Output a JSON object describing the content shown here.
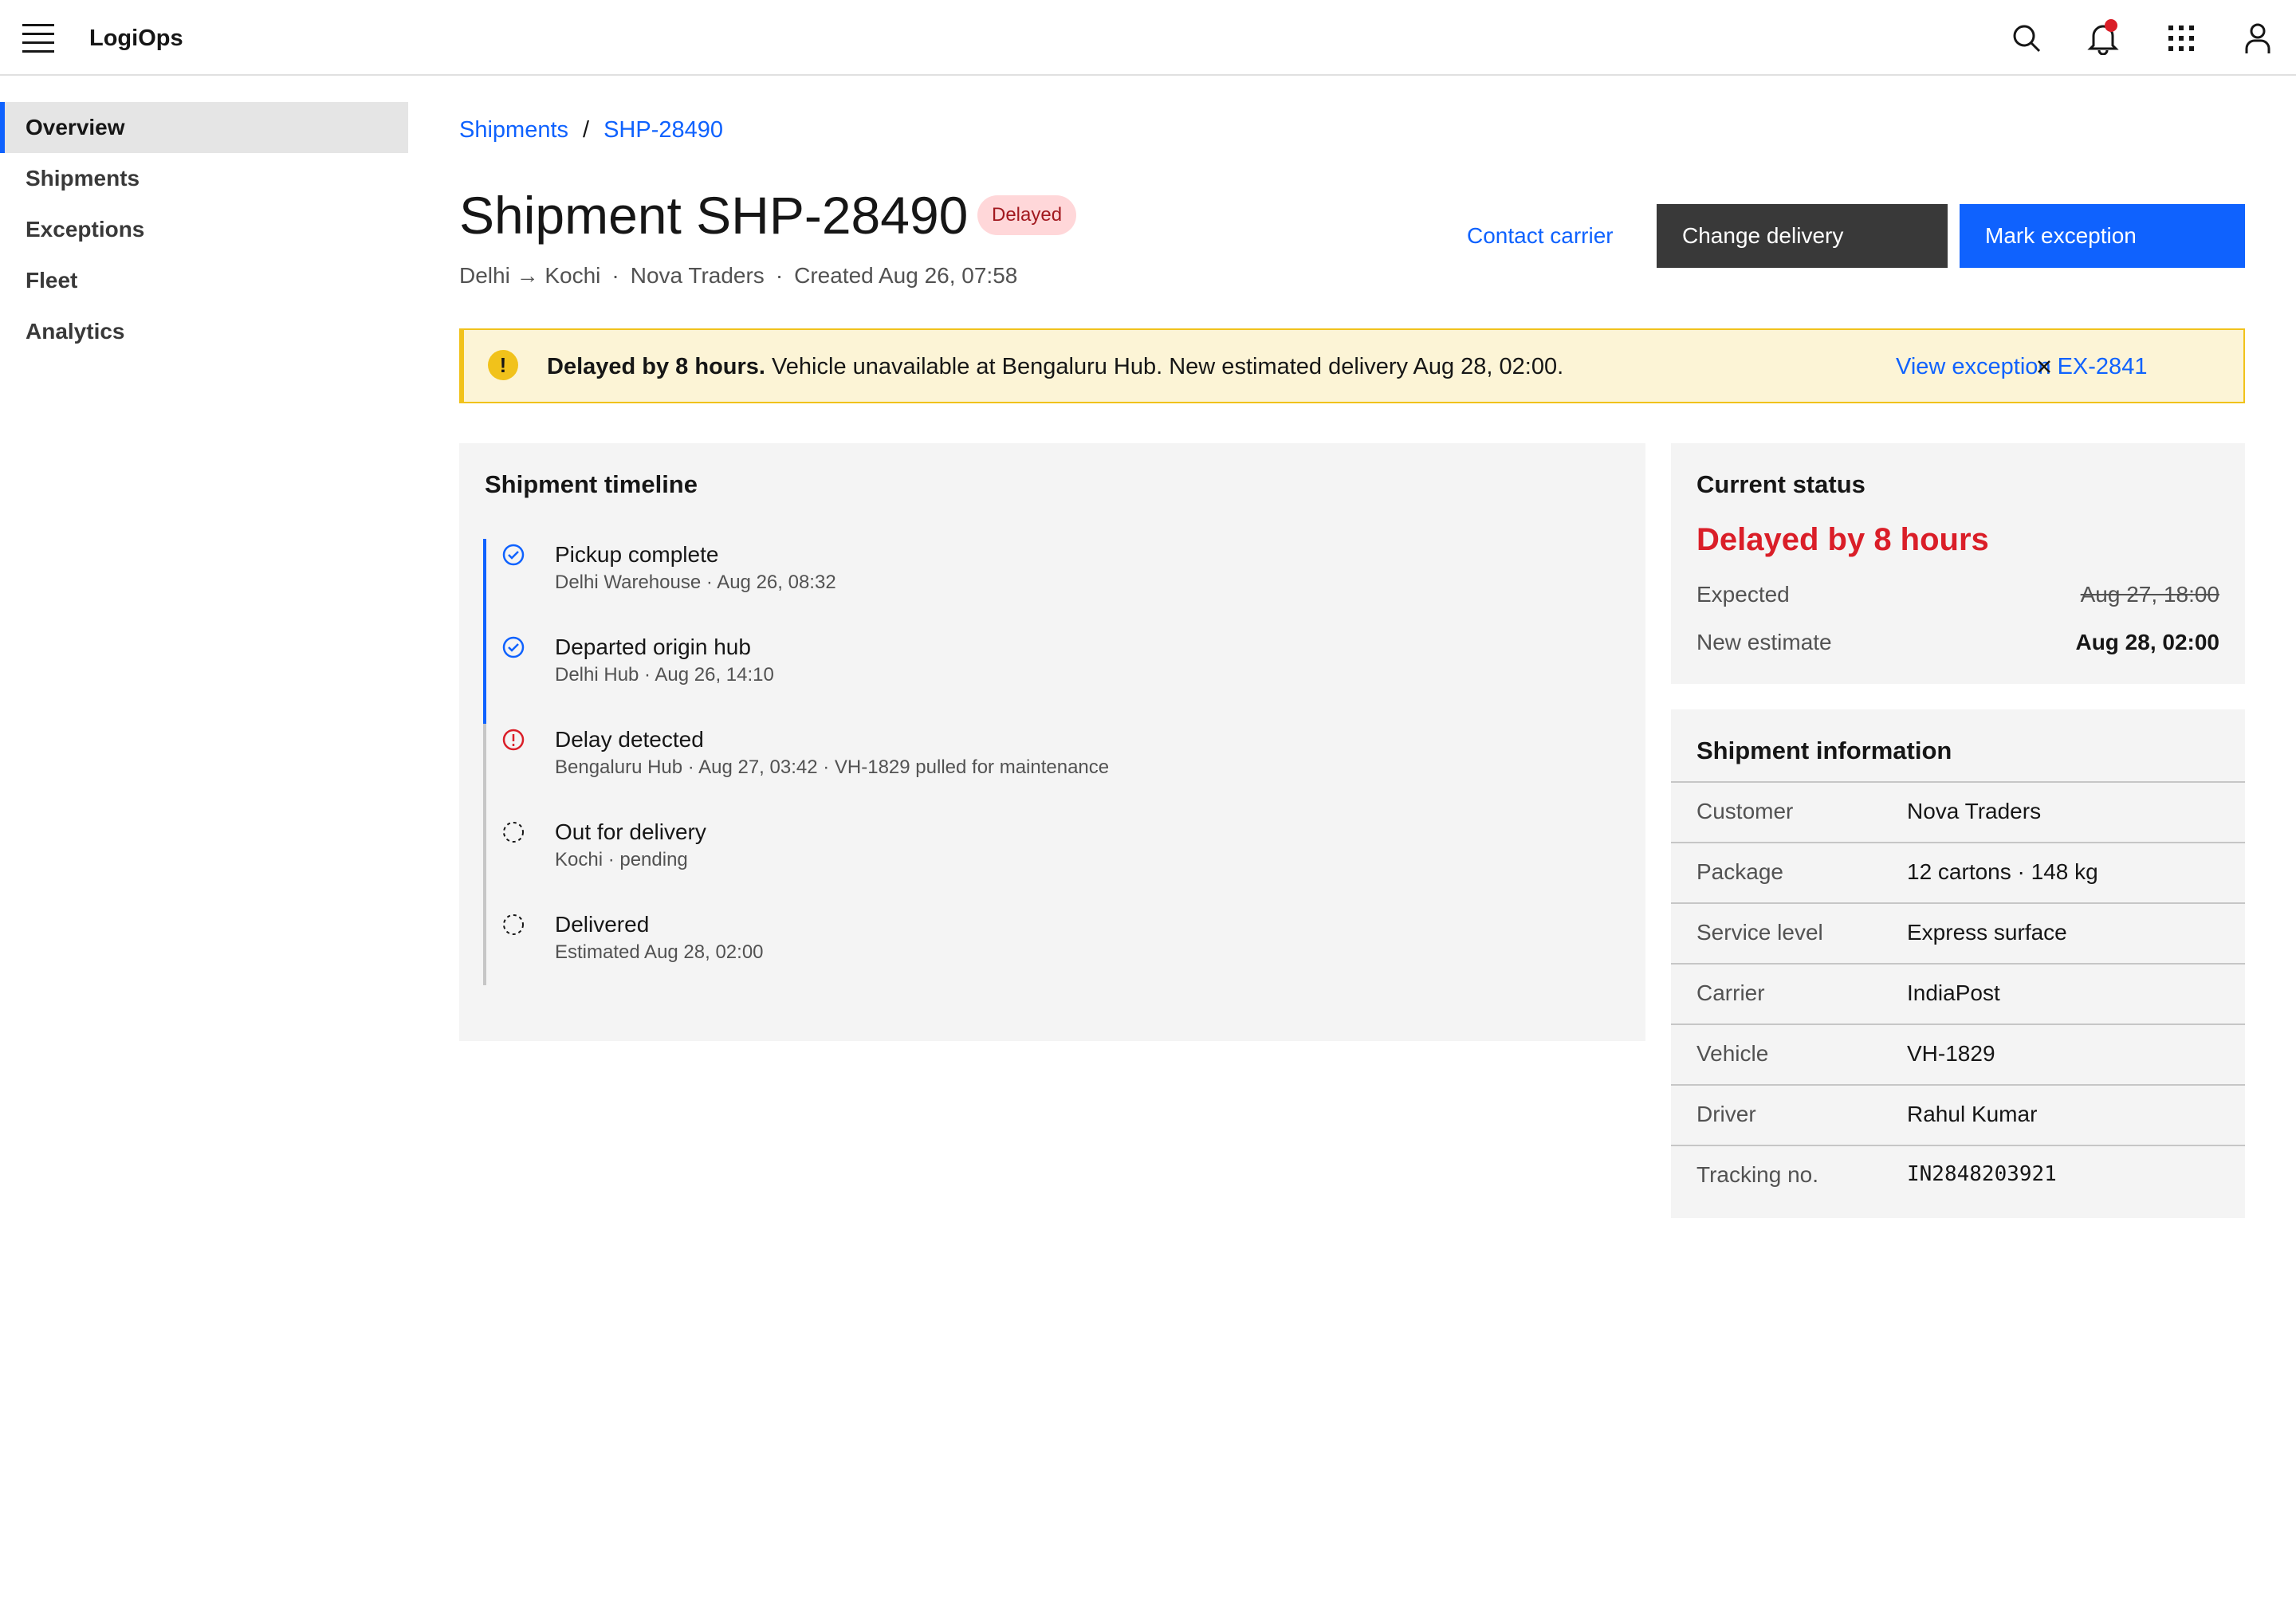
{
  "header": {
    "app_name": "LogiOps",
    "icons": [
      "menu-icon",
      "search-icon",
      "bell-icon",
      "app-switcher-icon",
      "user-icon"
    ],
    "has_notification": true
  },
  "sidebar": {
    "items": [
      {
        "label": "Overview",
        "active": true
      },
      {
        "label": "Shipments",
        "active": false
      },
      {
        "label": "Exceptions",
        "active": false
      },
      {
        "label": "Fleet",
        "active": false
      },
      {
        "label": "Analytics",
        "active": false
      }
    ]
  },
  "breadcrumb": {
    "items": [
      "Shipments",
      "SHP-28490"
    ],
    "separator": "/"
  },
  "page": {
    "title": "Shipment SHP-28490",
    "status_tag": "Delayed",
    "route": "Delhi → Kochi",
    "customer": "Nova Traders",
    "created": "Created Aug 26, 07:58",
    "separator": "·"
  },
  "actions": {
    "contact_carrier": "Contact carrier",
    "change_delivery": "Change delivery",
    "mark_exception": "Mark exception"
  },
  "banner": {
    "bold_text": "Delayed by 8 hours.",
    "text": " Vehicle unavailable at Bengaluru Hub. New estimated delivery Aug 28, 02:00.",
    "link": "View exception EX-2841"
  },
  "timeline": {
    "title": "Shipment timeline",
    "events": [
      {
        "title": "Pickup complete",
        "detail": "Delhi Warehouse · Aug 26, 08:32",
        "state": "done"
      },
      {
        "title": "Departed origin hub",
        "detail": "Delhi Hub · Aug 26, 14:10",
        "state": "done"
      },
      {
        "title": "Delay detected",
        "detail": "Bengaluru Hub · Aug 27, 03:42 · VH-1829 pulled for maintenance",
        "state": "error"
      },
      {
        "title": "Out for delivery",
        "detail": "Kochi · pending",
        "state": "pending"
      },
      {
        "title": "Delivered",
        "detail": "Estimated Aug 28, 02:00",
        "state": "pending"
      }
    ]
  },
  "current_status": {
    "title": "Current status",
    "headline": "Delayed by 8 hours",
    "expected_label": "Expected",
    "expected_value": "Aug 27, 18:00",
    "new_estimate_label": "New estimate",
    "new_estimate_value": "Aug 28, 02:00"
  },
  "shipment_info": {
    "title": "Shipment information",
    "rows": [
      {
        "label": "Customer",
        "value": "Nova Traders"
      },
      {
        "label": "Package",
        "value": "12 cartons · 148 kg"
      },
      {
        "label": "Service level",
        "value": "Express surface"
      },
      {
        "label": "Carrier",
        "value": "IndiaPost"
      },
      {
        "label": "Vehicle",
        "value": "VH-1829"
      },
      {
        "label": "Driver",
        "value": "Rahul Kumar"
      },
      {
        "label": "Tracking no.",
        "value": "IN2848203921"
      }
    ]
  },
  "colors": {
    "accent": "#0f62fe",
    "danger": "#da1e28",
    "warning": "#f1c21b",
    "warning_bg": "#fcf4d6"
  }
}
